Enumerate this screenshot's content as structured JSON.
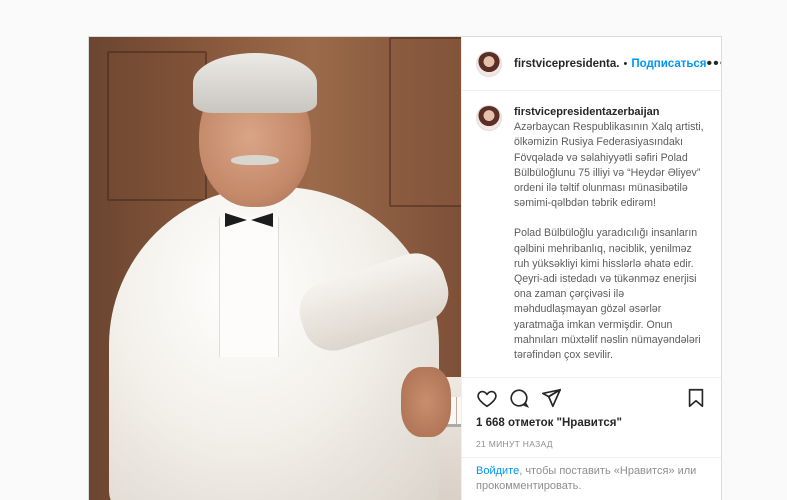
{
  "post": {
    "username": "firstvicepresidenta.",
    "dot": "•",
    "follow_label": "Подписаться",
    "more_label": "•••"
  },
  "caption": {
    "username": "firstvicepresidentazerbaijan",
    "paragraph1": "Azərbaycan Respublikasının Xalq artisti, ölkəmizin Rusiya Federasiyasındakı Fövqəladə və səlahiyyətli səfiri Polad Bülbüloğlunu 75 illiyi və “Heydər Əliyev” ordeni ilə təltif olunması münasibətilə səmimi-qəlbdən təbrik edirəm!",
    "paragraph2": "Polad Bülbüloğlu yaradıcılığı insanların qəlbini mehribanlıq, nəciblik, yenilməz ruh yüksəkliyi kimi hisslərlə əhatə edir. Qeyri-adi istedadı və tükənməz enerjisi ona zaman çərçivəsi ilə məhdudlaşmayan gözəl əsərlər yaratmağa imkan vermişdir. Onun mahnıları müxtəlif nəslin nümayəndələri tərəfindən çox sevilir."
  },
  "actions": {
    "like_icon": "heart-icon",
    "comment_icon": "comment-icon",
    "share_icon": "share-icon",
    "save_icon": "bookmark-icon"
  },
  "stats": {
    "likes": "1 668 отметок \"Нравится\"",
    "time": "21 МИНУТ НАЗАД"
  },
  "login_prompt": {
    "link": "Войдите",
    "text": ", чтобы поставить «Нравится» или прокомментировать."
  },
  "colors": {
    "accent": "#0095f6",
    "text": "#262626",
    "muted": "#8e8e8e",
    "border": "#dbdbdb"
  }
}
